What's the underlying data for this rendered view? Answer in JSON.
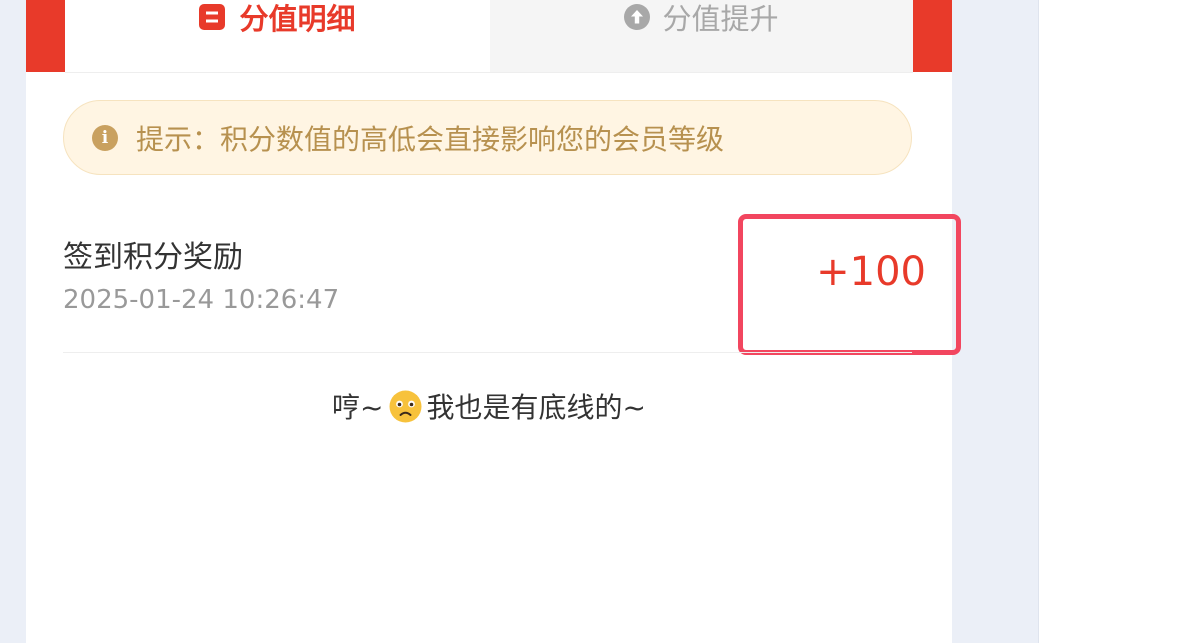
{
  "tabs": {
    "active": {
      "label": "分值明细",
      "icon": "list-icon"
    },
    "inactive": {
      "label": "分值提升",
      "icon": "arrow-up-circle-icon"
    }
  },
  "tip": {
    "icon": "info-icon",
    "text": "提示：积分数值的高低会直接影响您的会员等级"
  },
  "records": [
    {
      "title": "签到积分奖励",
      "time": "2025-01-24 10:26:47",
      "amount": "+100"
    }
  ],
  "end_message": {
    "prefix": "哼~",
    "emoji": "frowning-face-icon",
    "suffix": "我也是有底线的~"
  },
  "colors": {
    "brand_red": "#e83a2a",
    "highlight_border": "#f2465f",
    "tip_background": "#fff5e3",
    "tip_text": "#b7914f"
  }
}
